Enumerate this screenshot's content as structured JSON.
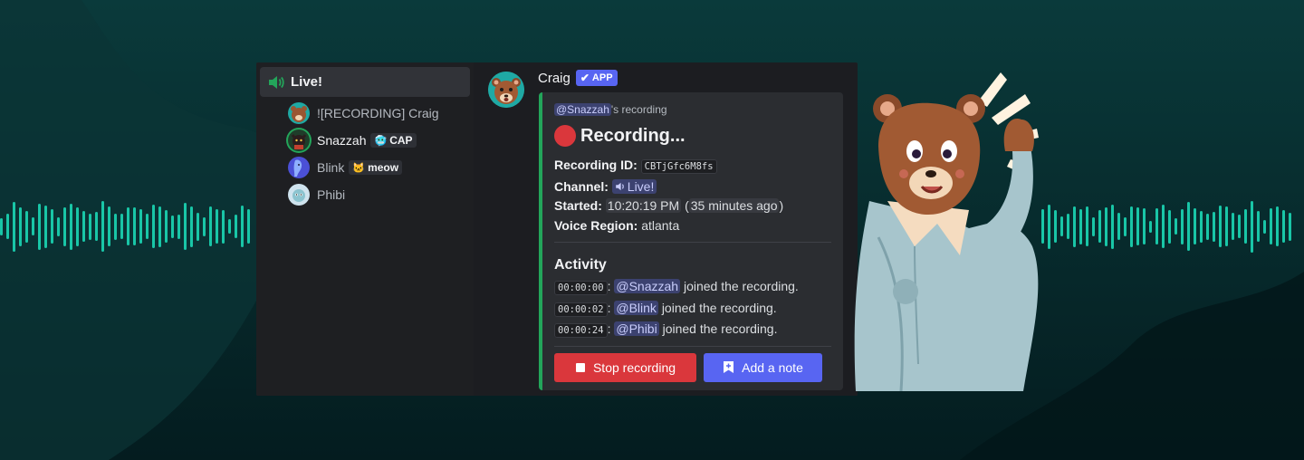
{
  "sidebar": {
    "channel_name": "Live!",
    "members": [
      {
        "name": "![RECORDING] Craig",
        "tag": null,
        "tag_icon": null
      },
      {
        "name": "Snazzah",
        "tag": "CAP",
        "tag_icon": "🥶"
      },
      {
        "name": "Blink",
        "tag": "meow",
        "tag_icon": "🐱"
      },
      {
        "name": "Phibi",
        "tag": null,
        "tag_icon": null
      }
    ]
  },
  "message": {
    "author": "Craig",
    "badge": "APP",
    "embed": {
      "author_mention": "@Snazzah",
      "author_suffix": "'s recording",
      "title": "Recording...",
      "recording_id_label": "Recording ID:",
      "recording_id": "CBTjGfc6M8fs",
      "channel_label": "Channel:",
      "channel": "Live!",
      "started_label": "Started:",
      "started_time": "10:20:19 PM",
      "started_relative": "35 minutes ago",
      "region_label": "Voice Region:",
      "region": "atlanta",
      "activity_title": "Activity",
      "activity": [
        {
          "time": "00:00:00",
          "user": "@Snazzah",
          "text": "joined the recording."
        },
        {
          "time": "00:00:02",
          "user": "@Blink",
          "text": "joined the recording."
        },
        {
          "time": "00:00:24",
          "user": "@Phibi",
          "text": "joined the recording."
        }
      ]
    },
    "buttons": {
      "stop_label": "Stop recording",
      "note_label": "Add a note"
    }
  },
  "colors": {
    "background": "#062a2c",
    "waveform": "#19c6a7",
    "recording_red": "#da373c",
    "blurple": "#5865f2",
    "embed_accent": "#23a55a"
  }
}
